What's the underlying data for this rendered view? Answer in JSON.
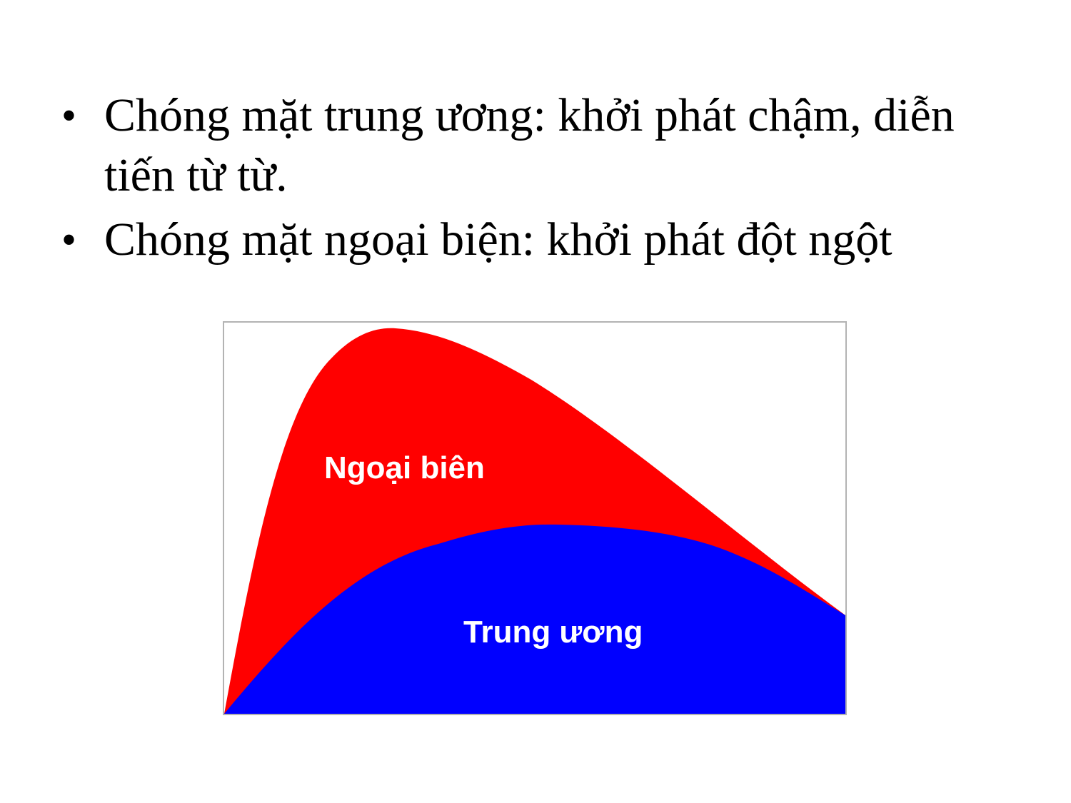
{
  "slide": {
    "bullets": [
      {
        "bullet": "•",
        "text": "Chóng mặt trung ương: khởi phát chậm, diễn tiến từ từ."
      },
      {
        "bullet": "•",
        "text": "Chóng mặt ngoại biện: khởi phát đột ngột"
      }
    ]
  },
  "figure": {
    "colors": {
      "peripheral": "#ff0000",
      "central": "#0000ff",
      "label": "#ffffff",
      "border": "#b3b3b3"
    },
    "labels": {
      "peripheral": "Ngoại biên",
      "central": "Trung ương"
    }
  }
}
